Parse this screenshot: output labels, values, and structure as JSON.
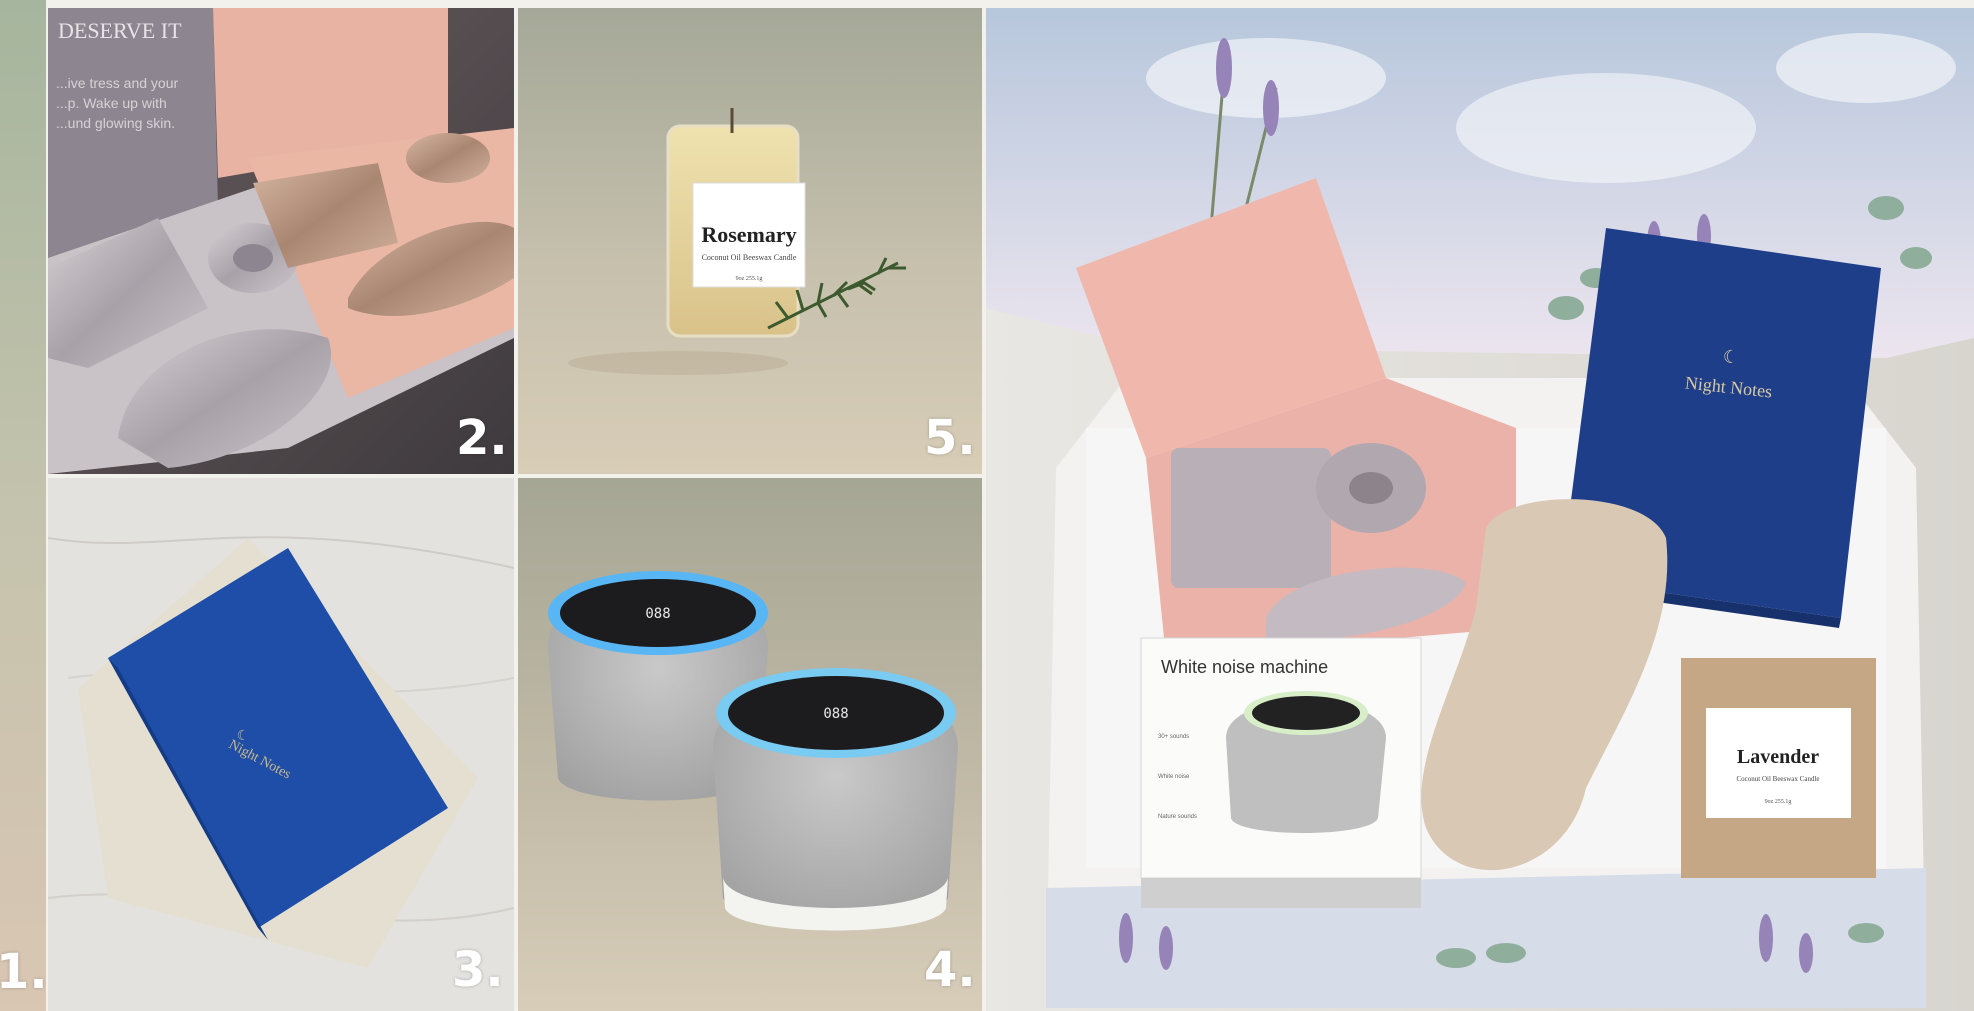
{
  "collage": {
    "panel_labels": [
      "1.",
      "2.",
      "3.",
      "4.",
      "5."
    ],
    "silk_box_text": {
      "heading": "DESERVE IT",
      "lines": [
        "...ive tress and your",
        "...p. Wake up with",
        "...und glowing skin."
      ]
    },
    "candle": {
      "name": "Rosemary",
      "subtitle": "Coconut Oil Beeswax Candle",
      "weight": "9oz 255.1g"
    },
    "journal": {
      "title": "Night Notes"
    },
    "noise_machine_box": {
      "title": "White noise machine",
      "features": [
        "30+ sounds",
        "White noise",
        "Nature sounds"
      ],
      "display": "088"
    },
    "lavender_candle": {
      "name": "Lavender",
      "subtitle": "Coconut Oil Beeswax Candle",
      "weight": "9oz 255.1g"
    }
  }
}
